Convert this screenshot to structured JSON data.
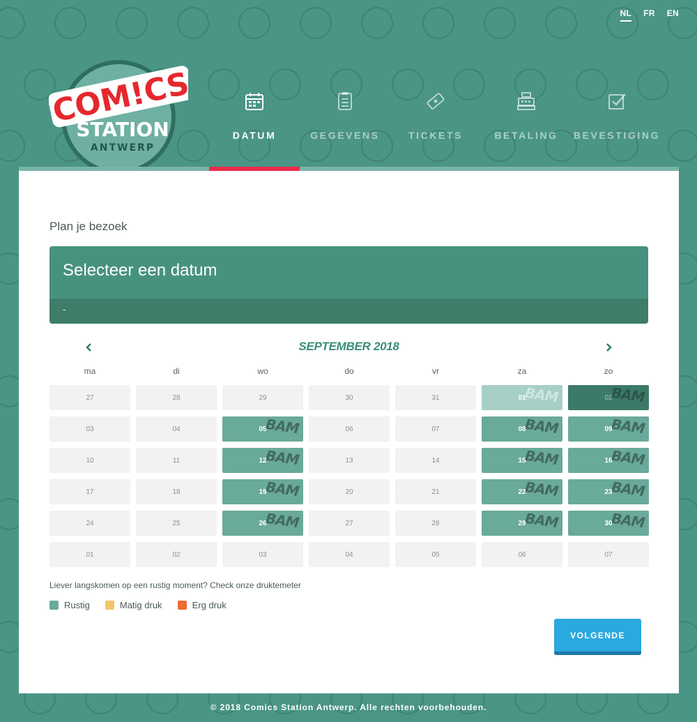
{
  "brand": {
    "logo_line1": "COM!CS",
    "logo_line2": "STATION",
    "logo_line3": "ANTWERP"
  },
  "languages": [
    {
      "label": "NL",
      "active": true
    },
    {
      "label": "FR",
      "active": false
    },
    {
      "label": "EN",
      "active": false
    }
  ],
  "steps": [
    {
      "label": "DATUM",
      "icon": "calendar-icon",
      "active": true
    },
    {
      "label": "GEGEVENS",
      "icon": "clipboard-icon",
      "active": false
    },
    {
      "label": "TICKETS",
      "icon": "ticket-icon",
      "active": false
    },
    {
      "label": "BETALING",
      "icon": "cash-register-icon",
      "active": false
    },
    {
      "label": "BEVESTIGING",
      "icon": "checkbox-icon",
      "active": false
    }
  ],
  "main": {
    "plan_title": "Plan je bezoek",
    "select_title": "Selecteer een datum",
    "select_sub": "-",
    "meter_text": "Liever langskomen op een rustig moment? Check onze druktemeter",
    "next_button": "VOLGENDE"
  },
  "calendar": {
    "month": "SEPTEMBER 2018",
    "prev_icon": "chevron-left-icon",
    "next_icon": "chevron-right-icon",
    "weekdays": [
      "ma",
      "di",
      "wo",
      "do",
      "vr",
      "za",
      "zo"
    ],
    "bam_text": "BAM",
    "days": [
      {
        "label": "27",
        "state": "inactive"
      },
      {
        "label": "28",
        "state": "inactive"
      },
      {
        "label": "29",
        "state": "inactive"
      },
      {
        "label": "30",
        "state": "inactive"
      },
      {
        "label": "31",
        "state": "inactive"
      },
      {
        "label": "01",
        "state": "light"
      },
      {
        "label": "02",
        "state": "selected"
      },
      {
        "label": "03",
        "state": "inactive"
      },
      {
        "label": "04",
        "state": "inactive"
      },
      {
        "label": "05",
        "state": "available"
      },
      {
        "label": "06",
        "state": "inactive"
      },
      {
        "label": "07",
        "state": "inactive"
      },
      {
        "label": "08",
        "state": "available"
      },
      {
        "label": "09",
        "state": "available"
      },
      {
        "label": "10",
        "state": "inactive"
      },
      {
        "label": "11",
        "state": "inactive"
      },
      {
        "label": "12",
        "state": "available"
      },
      {
        "label": "13",
        "state": "inactive"
      },
      {
        "label": "14",
        "state": "inactive"
      },
      {
        "label": "15",
        "state": "available"
      },
      {
        "label": "16",
        "state": "available"
      },
      {
        "label": "17",
        "state": "inactive"
      },
      {
        "label": "18",
        "state": "inactive"
      },
      {
        "label": "19",
        "state": "available"
      },
      {
        "label": "20",
        "state": "inactive"
      },
      {
        "label": "21",
        "state": "inactive"
      },
      {
        "label": "22",
        "state": "available"
      },
      {
        "label": "23",
        "state": "available"
      },
      {
        "label": "24",
        "state": "inactive"
      },
      {
        "label": "25",
        "state": "inactive"
      },
      {
        "label": "26",
        "state": "available"
      },
      {
        "label": "27",
        "state": "inactive"
      },
      {
        "label": "28",
        "state": "inactive"
      },
      {
        "label": "29",
        "state": "available"
      },
      {
        "label": "30",
        "state": "available"
      },
      {
        "label": "01",
        "state": "inactive"
      },
      {
        "label": "02",
        "state": "inactive"
      },
      {
        "label": "03",
        "state": "inactive"
      },
      {
        "label": "04",
        "state": "inactive"
      },
      {
        "label": "05",
        "state": "inactive"
      },
      {
        "label": "06",
        "state": "inactive"
      },
      {
        "label": "07",
        "state": "inactive"
      }
    ]
  },
  "legend": [
    {
      "label": "Rustig",
      "color": "#6aaa9b"
    },
    {
      "label": "Matig druk",
      "color": "#f5c56b"
    },
    {
      "label": "Erg druk",
      "color": "#ee6a36"
    }
  ],
  "colors": {
    "background": "#4a9585",
    "accent_red": "#ee2a4a",
    "button_blue": "#2aa9df"
  },
  "footer": "© 2018 Comics Station Antwerp. Alle rechten voorbehouden."
}
